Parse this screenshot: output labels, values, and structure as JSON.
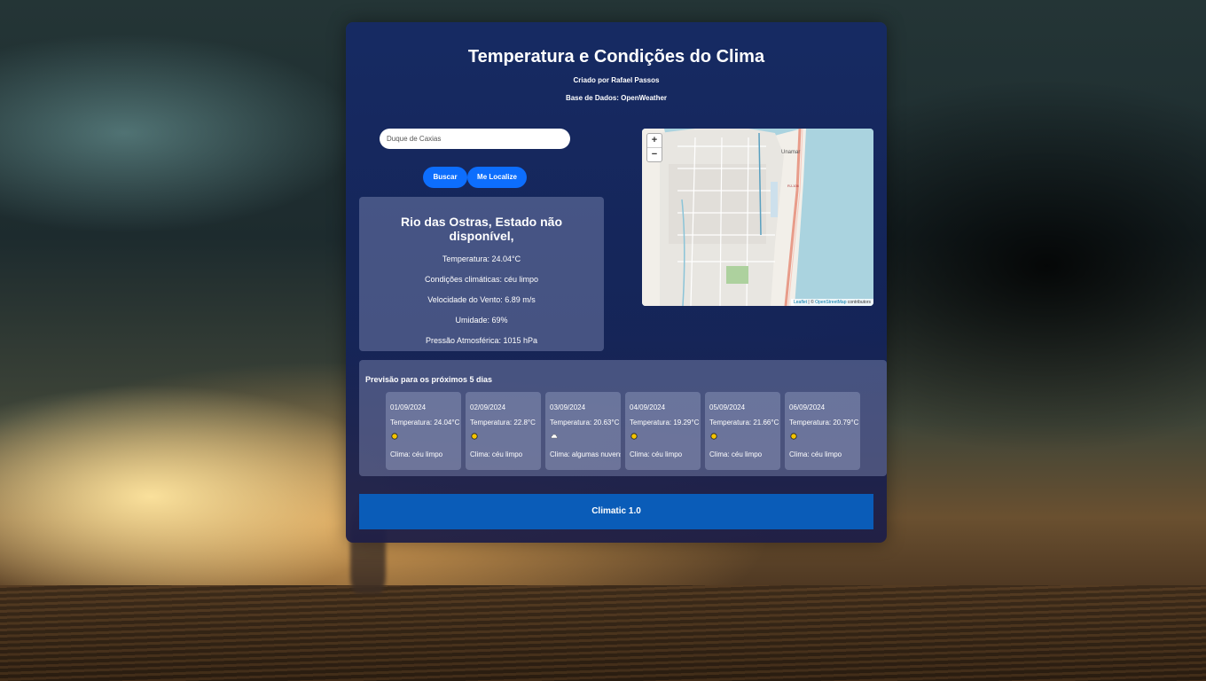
{
  "header": {
    "title": "Temperatura e Condições do Clima",
    "author": "Criado por Rafael Passos",
    "source": "Base de Dados: OpenWeather"
  },
  "search": {
    "value": "Duque de Caxias"
  },
  "buttons": {
    "search_label": "Buscar",
    "locate_label": "Me Localize"
  },
  "current": {
    "city": "Rio das Ostras, Estado não disponível,",
    "temperature": "Temperatura: 24.04°C",
    "conditions": "Condições climáticas: céu limpo",
    "wind": "Velocidade do Vento: 6.89 m/s",
    "humidity": "Umidade: 69%",
    "pressure": "Pressão Atmosférica: 1015 hPa"
  },
  "map": {
    "zoom_in": "+",
    "zoom_out": "−",
    "attribution_leaflet": "Leaflet",
    "attribution_sep": " | © ",
    "attribution_osm": "OpenStreetMap",
    "attribution_contrib": " contributors",
    "label_place": "Unamar",
    "label_road": "RJ-106"
  },
  "forecast": {
    "title": "Previsão para os próximos 5 dias",
    "days": [
      {
        "date": "01/09/2024",
        "temp": "Temperatura: 24.04°C",
        "icon": "sun-icon",
        "cond": "Clima: céu limpo"
      },
      {
        "date": "02/09/2024",
        "temp": "Temperatura: 22.8°C",
        "icon": "sun-icon",
        "cond": "Clima: céu limpo"
      },
      {
        "date": "03/09/2024",
        "temp": "Temperatura: 20.63°C",
        "icon": "cloud-icon",
        "cond": "Clima: algumas nuvens"
      },
      {
        "date": "04/09/2024",
        "temp": "Temperatura: 19.29°C",
        "icon": "sun-icon",
        "cond": "Clima: céu limpo"
      },
      {
        "date": "05/09/2024",
        "temp": "Temperatura: 21.66°C",
        "icon": "sun-icon",
        "cond": "Clima: céu limpo"
      },
      {
        "date": "06/09/2024",
        "temp": "Temperatura: 20.79°C",
        "icon": "sun-icon",
        "cond": "Clima: céu limpo"
      }
    ]
  },
  "footer": {
    "label": "Climatic 1.0"
  },
  "colors": {
    "accent": "#0d6efd",
    "footer": "#0a5cb8",
    "panel": "#162a64"
  }
}
